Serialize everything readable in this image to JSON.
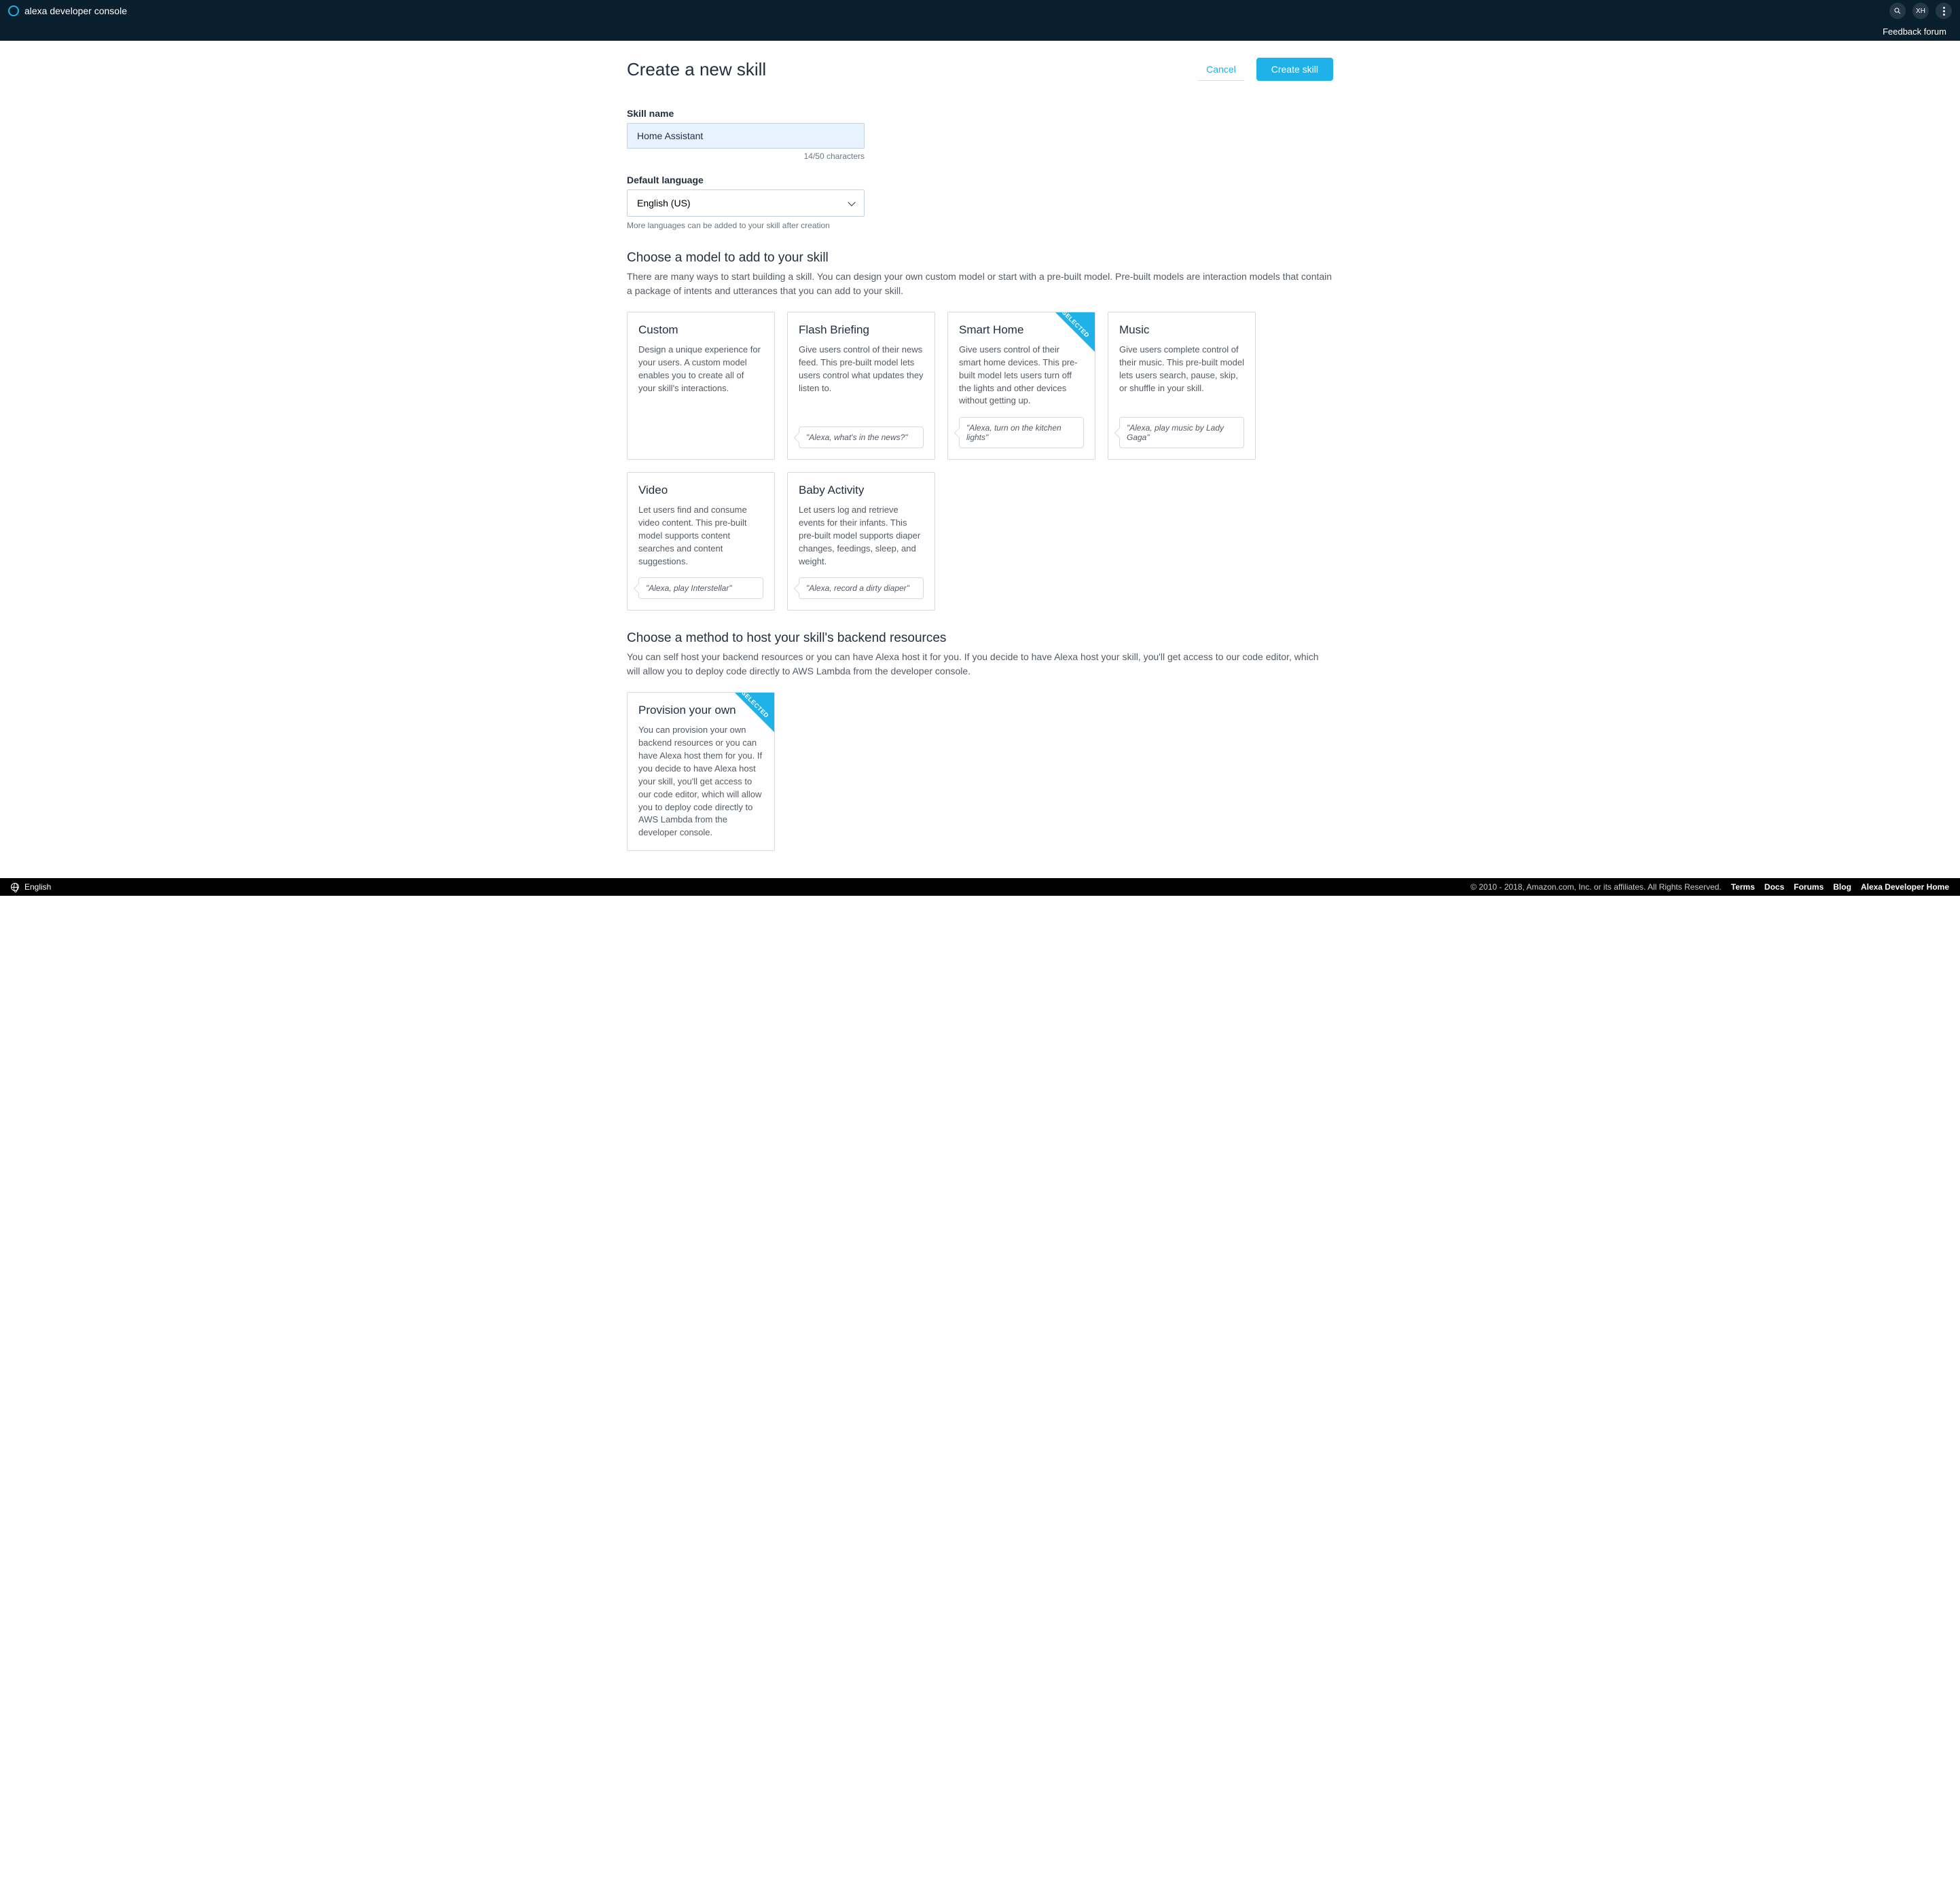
{
  "header": {
    "brand": "alexa developer console",
    "user_initials": "XH",
    "feedback": "Feedback forum"
  },
  "page": {
    "title": "Create a new skill",
    "cancel": "Cancel",
    "create": "Create skill"
  },
  "skill_name": {
    "label": "Skill name",
    "value": "Home Assistant",
    "counter": "14/50 characters"
  },
  "language": {
    "label": "Default language",
    "value": "English (US)",
    "hint": "More languages can be added to your skill after creation"
  },
  "model_section": {
    "heading": "Choose a model to add to your skill",
    "desc": "There are many ways to start building a skill. You can design your own custom model or start with a pre-built model.  Pre-built models are interaction models that contain a package of intents and utterances that you can add to your skill."
  },
  "models": [
    {
      "title": "Custom",
      "body": "Design a unique experience for your users. A custom model enables you to create all of your skill's interactions.",
      "example": null,
      "selected": false
    },
    {
      "title": "Flash Briefing",
      "body": "Give users control of their news feed. This pre-built model lets users control what updates they listen to.",
      "example": "\"Alexa, what's in the news?\"",
      "selected": false
    },
    {
      "title": "Smart Home",
      "body": "Give users control of their smart home devices. This pre-built model lets users turn off the lights and other devices without getting up.",
      "example": "\"Alexa, turn on the kitchen lights\"",
      "selected": true
    },
    {
      "title": "Music",
      "body": "Give users complete control of their music. This pre-built model lets users search, pause, skip, or shuffle in your skill.",
      "example": "\"Alexa, play music by Lady Gaga\"",
      "selected": false
    },
    {
      "title": "Video",
      "body": "Let users find and consume video content. This pre-built model supports content searches and content suggestions.",
      "example": "\"Alexa, play Interstellar\"",
      "selected": false
    },
    {
      "title": "Baby Activity",
      "body": "Let users log and retrieve events for their infants. This pre-built model supports diaper changes, feedings, sleep, and weight.",
      "example": "\"Alexa, record a dirty diaper\"",
      "selected": false
    }
  ],
  "host_section": {
    "heading": "Choose a method to host your skill's backend resources",
    "desc": "You can self host your backend resources or you can have Alexa host it for you. If you decide to have Alexa host your skill, you'll get access to our code editor, which will allow you to deploy code directly to AWS Lambda from the developer console."
  },
  "hosts": [
    {
      "title": "Provision your own",
      "body": "You can provision your own backend resources or you can have Alexa host them for you. If you decide to have Alexa host your skill, you'll get access to our code editor, which will allow you to deploy code directly to AWS Lambda from the developer console.",
      "selected": true
    }
  ],
  "selected_label": "SELECTED",
  "footer": {
    "lang": "English",
    "copyright": "© 2010 - 2018, Amazon.com, Inc. or its affiliates. All Rights Reserved.",
    "links": [
      "Terms",
      "Docs",
      "Forums",
      "Blog",
      "Alexa Developer Home"
    ]
  }
}
